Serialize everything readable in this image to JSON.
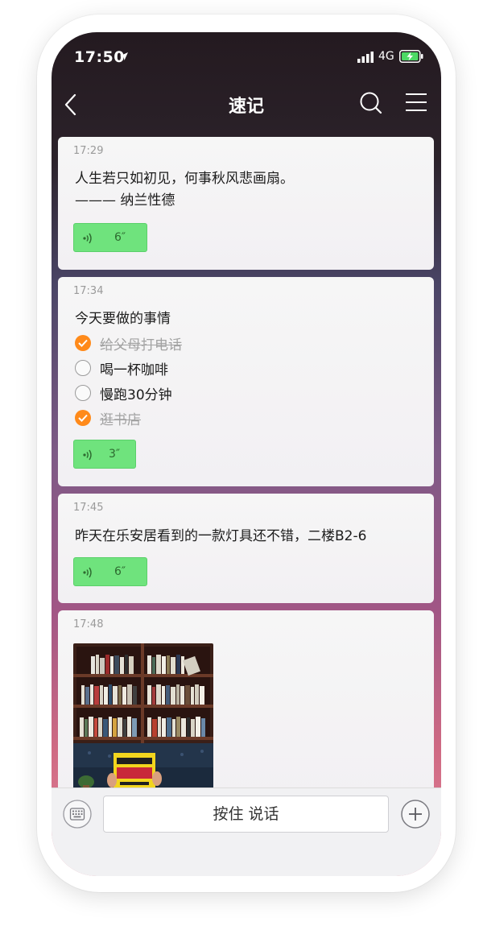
{
  "status_bar": {
    "time": "17:50",
    "network": "4G",
    "icons": [
      "location-arrow-icon",
      "signal-bars-icon",
      "battery-charging-icon"
    ]
  },
  "nav": {
    "title": "速记",
    "icons": [
      "back-icon",
      "search-icon",
      "menu-icon"
    ]
  },
  "notes": [
    {
      "time": "17:29",
      "lines": [
        "人生若只如初见，何事秋风悲画扇。",
        "——— 纳兰性德"
      ],
      "voice": {
        "duration": "6″"
      }
    },
    {
      "time": "17:34",
      "heading": "今天要做的事情",
      "todos": [
        {
          "text": "给父母打电话",
          "done": true
        },
        {
          "text": "喝一杯咖啡",
          "done": false
        },
        {
          "text": "慢跑30分钟",
          "done": false
        },
        {
          "text": "逛书店",
          "done": true
        }
      ],
      "voice": {
        "duration": "3″"
      }
    },
    {
      "time": "17:45",
      "lines": [
        "昨天在乐安居看到的一款灯具还不错，二楼B2-6"
      ],
      "voice": {
        "duration": "6″"
      }
    },
    {
      "time": "17:48",
      "image": "bookshelf-photo"
    }
  ],
  "input_bar": {
    "talk_label": "按住 说话",
    "icons": [
      "keyboard-icon",
      "plus-icon"
    ]
  },
  "colors": {
    "accent_check": "#ff8a1a",
    "voice_badge": "#6fe37d",
    "header_bg": "#241a20"
  }
}
